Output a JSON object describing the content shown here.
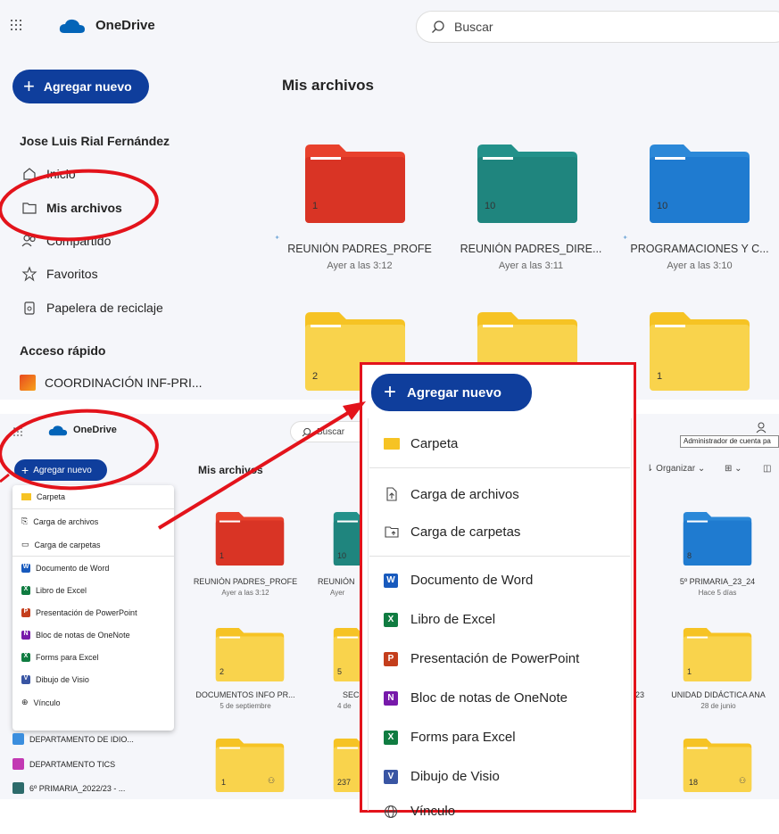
{
  "top": {
    "brand": "OneDrive",
    "search_placeholder": "Buscar",
    "add_new": "Agregar nuevo",
    "page_title": "Mis archivos",
    "user_name": "Jose Luis Rial Fernández",
    "nav": [
      {
        "label": "Inicio",
        "icon": "home-icon"
      },
      {
        "label": "Mis archivos",
        "icon": "folder-icon"
      },
      {
        "label": "Compartido",
        "icon": "people-icon"
      },
      {
        "label": "Favoritos",
        "icon": "star-icon"
      },
      {
        "label": "Papelera de reciclaje",
        "icon": "recycle-bin-icon"
      }
    ],
    "quick_access_title": "Acceso rápido",
    "quick_access": [
      {
        "label": "COORDINACIÓN INF-PRI..."
      }
    ],
    "folders": [
      {
        "count": "1",
        "name": "REUNIÓN PADRES_PROFE",
        "date": "Ayer a las 3:12",
        "color": "red",
        "new": true
      },
      {
        "count": "10",
        "name": "REUNIÓN PADRES_DIRE...",
        "date": "Ayer a las 3:11",
        "color": "teal",
        "new": false
      },
      {
        "count": "10",
        "name": "PROGRAMACIONES Y C...",
        "date": "Ayer a las 3:10",
        "color": "blue",
        "new": true
      },
      {
        "count": "2",
        "color": "yellow"
      },
      {
        "count": "",
        "color": "yellow"
      },
      {
        "count": "1",
        "color": "yellow"
      }
    ]
  },
  "bottom": {
    "brand": "OneDrive",
    "search_placeholder": "Buscar",
    "add_new": "Agregar nuevo",
    "page_title": "Mis archivos",
    "admin_tooltip": "Administrador de cuenta pa",
    "toolbar": {
      "organize": "Organizar",
      "view": "88"
    },
    "menu": [
      {
        "label": "Carpeta",
        "icon": "folder-icon"
      },
      {
        "label": "Carga de archivos",
        "icon": "file-upload-icon"
      },
      {
        "label": "Carga de carpetas",
        "icon": "folder-upload-icon"
      },
      {
        "label": "Documento de Word",
        "icon": "word-icon"
      },
      {
        "label": "Libro de Excel",
        "icon": "excel-icon"
      },
      {
        "label": "Presentación de PowerPoint",
        "icon": "powerpoint-icon"
      },
      {
        "label": "Bloc de notas de OneNote",
        "icon": "onenote-icon"
      },
      {
        "label": "Forms para Excel",
        "icon": "forms-icon"
      },
      {
        "label": "Dibujo de Visio",
        "icon": "visio-icon"
      },
      {
        "label": "Vínculo",
        "icon": "globe-icon"
      }
    ],
    "quick_access": [
      {
        "label": "DEPARTAMENTO DE IDIO..."
      },
      {
        "label": "DEPARTAMENTO TICS"
      },
      {
        "label": "6º PRIMARIA_2022/23 - ..."
      }
    ],
    "folders": [
      {
        "count": "1",
        "name": "REUNIÓN PADRES_PROFE",
        "date": "Ayer a las 3:12",
        "color": "red"
      },
      {
        "count": "10",
        "name": "REUNIÓN",
        "date": "Ayer",
        "color": "teal"
      },
      {
        "count": "8",
        "name": "5º PRIMARIA_23_24",
        "date": "Hace 5 días",
        "color": "blue"
      },
      {
        "count": "2",
        "name": "DOCUMENTOS INFO PR...",
        "date": "5 de septiembre",
        "color": "yellow"
      },
      {
        "count": "5",
        "name": "SEC",
        "date": "4 de",
        "color": "yellow"
      },
      {
        "count": "1",
        "name": "UNIDAD DIDÁCTICA ANA",
        "date": "28 de junio",
        "color": "yellow"
      },
      {
        "count": "1",
        "color": "yellow"
      },
      {
        "count": "237",
        "color": "yellow"
      },
      {
        "count": "18",
        "color": "yellow"
      }
    ],
    "extra_name_fragment": "23"
  },
  "zoom_menu": {
    "add_new": "Agregar nuevo",
    "items": [
      {
        "label": "Carpeta",
        "icon": "folder-icon"
      },
      {
        "label": "Carga de archivos",
        "icon": "file-upload-icon"
      },
      {
        "label": "Carga de carpetas",
        "icon": "folder-upload-icon"
      },
      {
        "label": "Documento de Word",
        "icon": "word-icon"
      },
      {
        "label": "Libro de Excel",
        "icon": "excel-icon"
      },
      {
        "label": "Presentación de PowerPoint",
        "icon": "powerpoint-icon"
      },
      {
        "label": "Bloc de notas de OneNote",
        "icon": "onenote-icon"
      },
      {
        "label": "Forms para Excel",
        "icon": "forms-icon"
      },
      {
        "label": "Dibujo de Visio",
        "icon": "visio-icon"
      },
      {
        "label": "Vínculo",
        "icon": "globe-icon"
      }
    ]
  },
  "colors": {
    "brand_blue": "#0f3e9c",
    "annotation_red": "#e3131b",
    "folder_red": "#e8412c",
    "folder_teal": "#23918a",
    "folder_blue": "#2b88d8",
    "folder_yellow": "#f6c324"
  }
}
